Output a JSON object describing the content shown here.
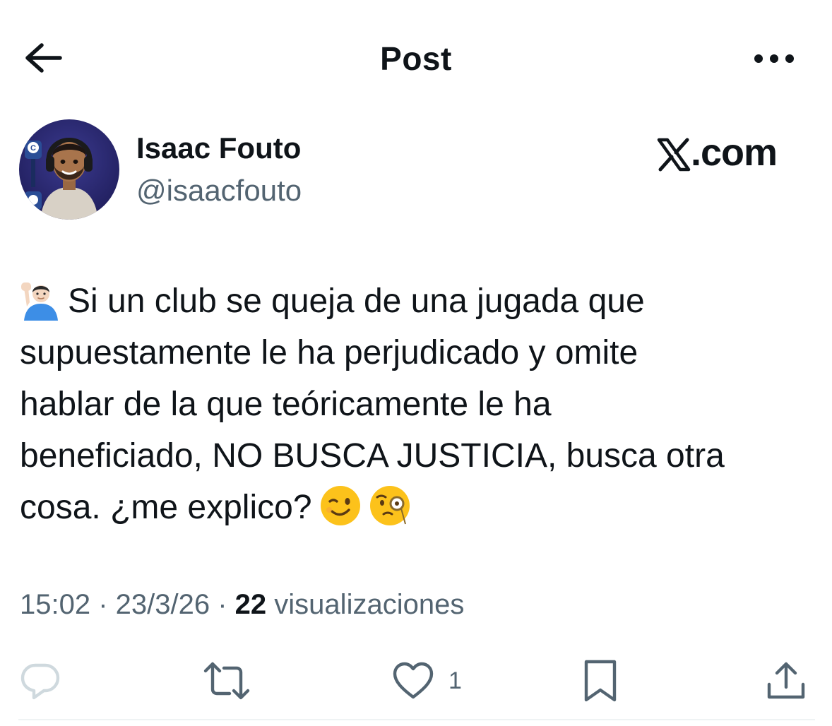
{
  "header": {
    "title": "Post",
    "back_icon": "arrow-left-icon",
    "more_icon": "ellipsis-horizontal-icon"
  },
  "author": {
    "name": "Isaac Fouto",
    "handle": "@isaacfouto",
    "avatar_icon": "cartoon-avatar"
  },
  "source_brand": {
    "text": ".com",
    "logo_icon": "x-logo-icon"
  },
  "post": {
    "lead_emoji_icon": "person-raising-hand-emoji-icon",
    "lines": [
      "Si un club se queja de una jugada que",
      "supuestamente le ha perjudicado y omite",
      "hablar de la que teóricamente le ha",
      "beneficiado, NO BUSCA JUSTICIA, busca otra",
      "cosa. ¿me explico?"
    ],
    "trail_emoji_icons": [
      "winking-face-emoji-icon",
      "face-with-monocle-emoji-icon"
    ]
  },
  "meta": {
    "time": "15:02",
    "separator": " · ",
    "date": "23/3/26",
    "views_count": "22",
    "views_label": "visualizaciones"
  },
  "actions": {
    "reply_icon": "reply-icon",
    "repost_icon": "repost-icon",
    "like_icon": "heart-icon",
    "like_count": "1",
    "bookmark_icon": "bookmark-icon",
    "share_icon": "share-icon"
  },
  "colors": {
    "text_primary": "#0f1419",
    "text_secondary": "#536471",
    "reply_icon_disabled": "#cfd9de",
    "divider": "#eff3f4"
  }
}
